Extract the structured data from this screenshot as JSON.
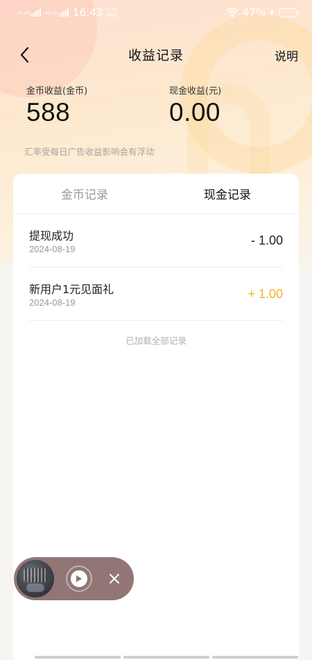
{
  "status_bar": {
    "sim1_tag": "4G HD",
    "sim2_tag": "4G HD",
    "time": "16:43",
    "net_speed_value": "0.90",
    "net_speed_unit": "KB/s",
    "battery": "47%",
    "battery_level": 0.47
  },
  "nav": {
    "title": "收益记录",
    "help": "说明"
  },
  "summary": {
    "coin_label": "金币收益(金币)",
    "coin_value": "588",
    "cash_label": "现金收益(元)",
    "cash_value": "0.00",
    "notice": "汇率受每日广告收益影响会有浮动"
  },
  "tabs": [
    {
      "label": "金币记录",
      "active": false
    },
    {
      "label": "现金记录",
      "active": true
    }
  ],
  "records": [
    {
      "title": "提现成功",
      "date": "2024-08-19",
      "amount": "- 1.00",
      "type": "neg"
    },
    {
      "title": "新用户1元见面礼",
      "date": "2024-08-19",
      "amount": "+ 1.00",
      "type": "pos"
    }
  ],
  "footer_text": "已加载全部记录",
  "colors": {
    "positive_amount": "#f2b02a",
    "header_gradient_top": "#fde1d2",
    "mini_player_bg": "#8d6e6e"
  },
  "icons": {
    "back": "chevron-left-icon",
    "play": "play-icon",
    "close": "close-icon"
  }
}
